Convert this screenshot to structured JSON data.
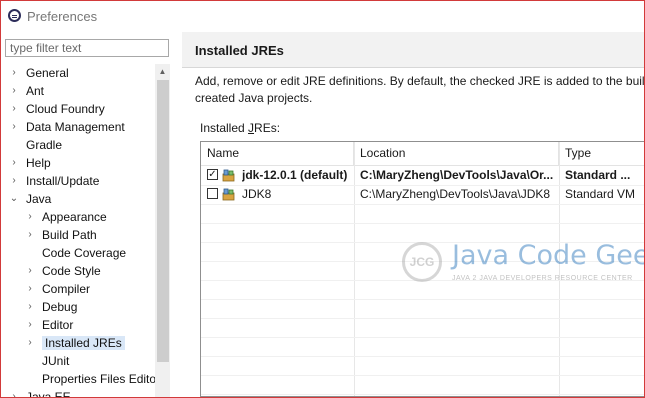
{
  "window": {
    "title": "Preferences"
  },
  "sidebar": {
    "filter_placeholder": "type filter text",
    "items": [
      {
        "label": "General",
        "arrow": "›",
        "depth": 0
      },
      {
        "label": "Ant",
        "arrow": "›",
        "depth": 0
      },
      {
        "label": "Cloud Foundry",
        "arrow": "›",
        "depth": 0
      },
      {
        "label": "Data Management",
        "arrow": "›",
        "depth": 0
      },
      {
        "label": "Gradle",
        "arrow": "",
        "depth": 0
      },
      {
        "label": "Help",
        "arrow": "›",
        "depth": 0
      },
      {
        "label": "Install/Update",
        "arrow": "›",
        "depth": 0
      },
      {
        "label": "Java",
        "arrow": "⌄",
        "depth": 0
      },
      {
        "label": "Appearance",
        "arrow": "›",
        "depth": 1
      },
      {
        "label": "Build Path",
        "arrow": "›",
        "depth": 1
      },
      {
        "label": "Code Coverage",
        "arrow": "",
        "depth": 1
      },
      {
        "label": "Code Style",
        "arrow": "›",
        "depth": 1
      },
      {
        "label": "Compiler",
        "arrow": "›",
        "depth": 1
      },
      {
        "label": "Debug",
        "arrow": "›",
        "depth": 1
      },
      {
        "label": "Editor",
        "arrow": "›",
        "depth": 1
      },
      {
        "label": "Installed JREs",
        "arrow": "›",
        "depth": 1,
        "selected": true
      },
      {
        "label": "JUnit",
        "arrow": "",
        "depth": 1
      },
      {
        "label": "Properties Files Editor",
        "arrow": "",
        "depth": 1
      },
      {
        "label": "Java EE",
        "arrow": "›",
        "depth": 0
      }
    ]
  },
  "main": {
    "title": "Installed JREs",
    "description_line1": "Add, remove or edit JRE definitions. By default, the checked JRE is added to the build",
    "description_line2": "created Java projects.",
    "installed_label_prefix": "Installed ",
    "installed_label_mnemonic": "J",
    "installed_label_suffix": "REs:",
    "columns": [
      "Name",
      "Location",
      "Type"
    ],
    "rows": [
      {
        "name": "jdk-12.0.1 (default)",
        "location": "C:\\MaryZheng\\DevTools\\Java\\Or...",
        "type": "Standard ...",
        "checked": true,
        "bold": true
      },
      {
        "name": "JDK8",
        "location": "C:\\MaryZheng\\DevTools\\Java\\JDK8",
        "type": "Standard VM",
        "checked": false,
        "bold": false
      }
    ]
  },
  "watermark": {
    "logo_text": "JCG",
    "title": "Java Code Geeks",
    "subtitle": "JAVA 2 JAVA DEVELOPERS RESOURCE CENTER"
  },
  "icons": {
    "app": "eclipse-icon",
    "jre": "jre-library-icon",
    "check": "check-icon"
  }
}
